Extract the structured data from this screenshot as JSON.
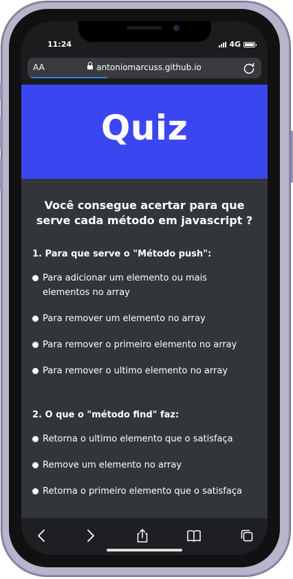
{
  "status_bar": {
    "time": "11:24",
    "network": "4G"
  },
  "browser": {
    "aa_label": "AA",
    "url": "antoniomarcuss.github.io"
  },
  "quiz": {
    "logo": "Quiz",
    "intro": "Você consegue acertar para que serve cada método em javascript ?",
    "questions": [
      {
        "title": "1. Para que serve o \"Método push\":",
        "options": [
          "Para adicionar um elemento ou mais elementos no array",
          "Para remover um elemento no array",
          "Para remover o primeiro elemento no array",
          "Para remover o ultimo elemento no array"
        ]
      },
      {
        "title": "2. O que o \"método find\" faz:",
        "options": [
          "Retorna o ultimo elemento que o satisfaça",
          "Remove um elemento no array",
          "Retorna o primeiro elemento que o satisfaça"
        ]
      }
    ]
  },
  "toolbar_icons": [
    "back-icon",
    "forward-icon",
    "share-icon",
    "bookmarks-icon",
    "tabs-icon"
  ],
  "colors": {
    "banner": "#3b46f1",
    "page_background": "#323539",
    "progress": "#2f7cf6"
  }
}
